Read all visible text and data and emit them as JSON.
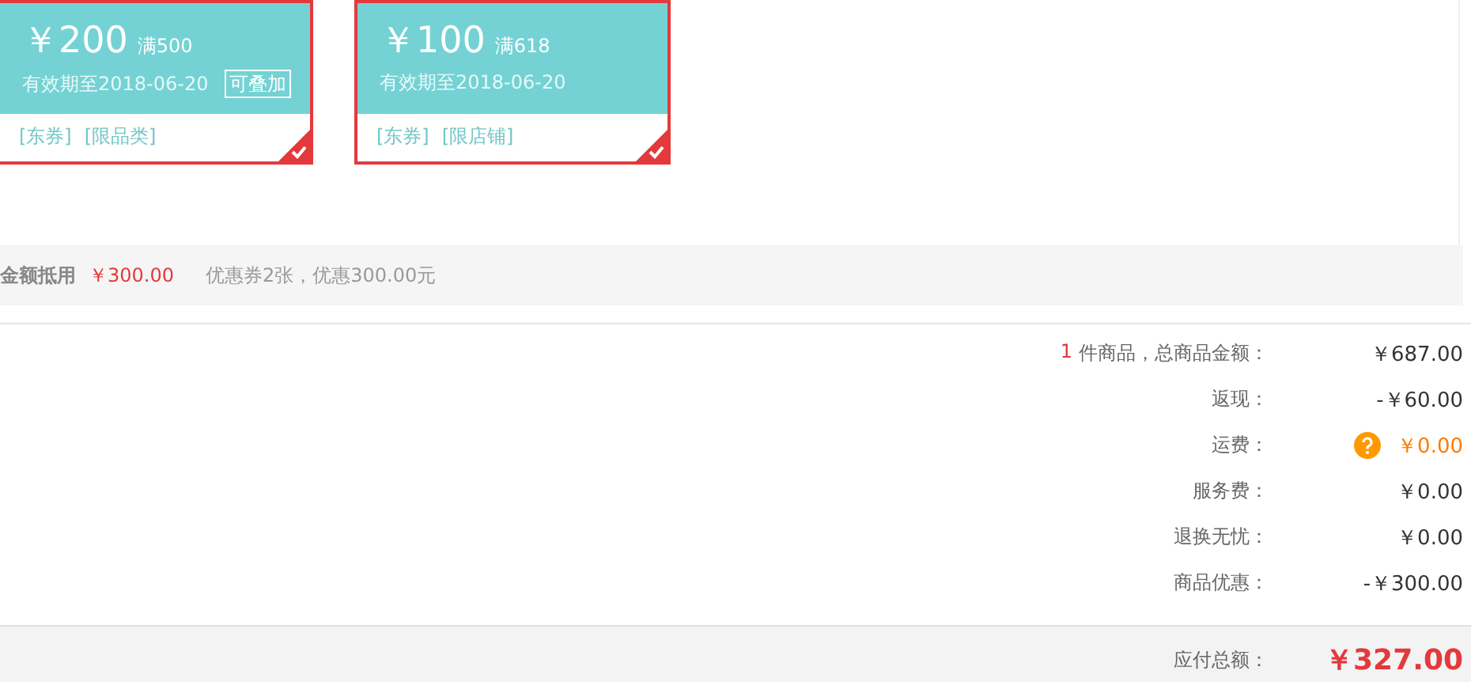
{
  "coupons": [
    {
      "amount": "￥200",
      "threshold": "满500",
      "validity": "有效期至2018-06-20",
      "tag": "可叠加",
      "scopes": [
        "[东券]",
        "[限品类]"
      ],
      "selected": true
    },
    {
      "amount": "￥100",
      "threshold": "满618",
      "validity": "有效期至2018-06-20",
      "scopes": [
        "[东券]",
        "[限店铺]"
      ],
      "selected": true
    }
  ],
  "discount_bar": {
    "label": "金额抵用",
    "amount": "￥300.00",
    "note": "优惠券2张，优惠300.00元"
  },
  "summary": [
    {
      "kind": "count",
      "count": "1",
      "label": "件商品，总商品金额：",
      "value": "￥687.00"
    },
    {
      "kind": "plain",
      "label": "返现：",
      "value": "-￥60.00"
    },
    {
      "kind": "help",
      "label": "运费：",
      "value": "￥0.00"
    },
    {
      "kind": "plain",
      "label": "服务费：",
      "value": "￥0.00"
    },
    {
      "kind": "plain",
      "label": "退换无忧：",
      "value": "￥0.00"
    },
    {
      "kind": "plain",
      "label": "商品优惠：",
      "value": "-￥300.00"
    }
  ],
  "total": {
    "label": "应付总额：",
    "value": "￥327.00"
  }
}
